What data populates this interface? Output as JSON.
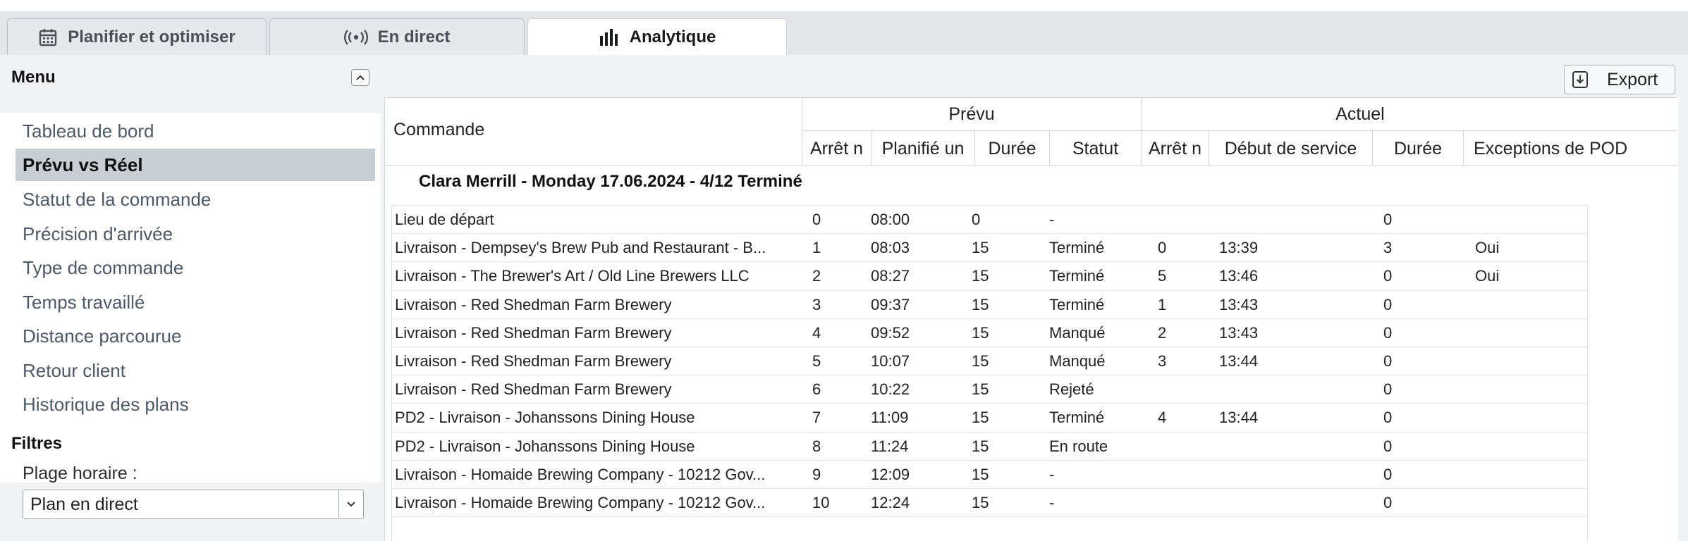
{
  "tabs": [
    {
      "label": "Planifier et optimiser",
      "icon": "calendar-icon"
    },
    {
      "label": "En direct",
      "icon": "broadcast-icon"
    },
    {
      "label": "Analytique",
      "icon": "bar-chart-icon"
    }
  ],
  "sidebar": {
    "menu_title": "Menu",
    "items": [
      {
        "label": "Tableau de bord"
      },
      {
        "label": "Prévu vs Réel"
      },
      {
        "label": "Statut de la commande"
      },
      {
        "label": "Précision d'arrivée"
      },
      {
        "label": "Type de commande"
      },
      {
        "label": "Temps travaillé"
      },
      {
        "label": "Distance parcourue"
      },
      {
        "label": "Retour client"
      },
      {
        "label": "Historique des plans"
      }
    ],
    "active_item": "Prévu vs Réel",
    "filters_title": "Filtres",
    "plage_label": "Plage horaire :",
    "plage_value": "Plan en direct"
  },
  "toolbar": {
    "export_label": "Export"
  },
  "table": {
    "commande_header": "Commande",
    "prevu_header": "Prévu",
    "actuel_header": "Actuel",
    "columns": {
      "arret_prevu": "Arrêt n",
      "planifie": "Planifié un",
      "duree_prevu": "Durée",
      "statut": "Statut",
      "arret_actuel": "Arrêt n",
      "debut_service": "Début de service",
      "duree_actuel": "Durée",
      "exceptions": "Exceptions de POD"
    },
    "group_title": "Clara Merrill - Monday 17.06.2024 - 4/12 Terminé",
    "rows": [
      {
        "commande": "Lieu de départ",
        "arret": "0",
        "planifie": "08:00",
        "duree": "0",
        "statut": "-",
        "arret_actuel": "",
        "debut": "",
        "duree_actuel": "0",
        "pod": ""
      },
      {
        "commande": "Livraison - Dempsey's Brew Pub and Restaurant - B...",
        "arret": "1",
        "planifie": "08:03",
        "duree": "15",
        "statut": "Terminé",
        "arret_actuel": "0",
        "debut": "13:39",
        "duree_actuel": "3",
        "pod": "Oui"
      },
      {
        "commande": "Livraison - The Brewer's Art / Old Line Brewers LLC",
        "arret": "2",
        "planifie": "08:27",
        "duree": "15",
        "statut": "Terminé",
        "arret_actuel": "5",
        "debut": "13:46",
        "duree_actuel": "0",
        "pod": "Oui"
      },
      {
        "commande": "Livraison - Red Shedman Farm Brewery",
        "arret": "3",
        "planifie": "09:37",
        "duree": "15",
        "statut": "Terminé",
        "arret_actuel": "1",
        "debut": "13:43",
        "duree_actuel": "0",
        "pod": ""
      },
      {
        "commande": "Livraison - Red Shedman Farm Brewery",
        "arret": "4",
        "planifie": "09:52",
        "duree": "15",
        "statut": "Manqué",
        "arret_actuel": "2",
        "debut": "13:43",
        "duree_actuel": "0",
        "pod": ""
      },
      {
        "commande": "Livraison - Red Shedman Farm Brewery",
        "arret": "5",
        "planifie": "10:07",
        "duree": "15",
        "statut": "Manqué",
        "arret_actuel": "3",
        "debut": "13:44",
        "duree_actuel": "0",
        "pod": ""
      },
      {
        "commande": "Livraison - Red Shedman Farm Brewery",
        "arret": "6",
        "planifie": "10:22",
        "duree": "15",
        "statut": "Rejeté",
        "arret_actuel": "",
        "debut": "",
        "duree_actuel": "0",
        "pod": ""
      },
      {
        "commande": "PD2 - Livraison - Johanssons Dining House",
        "arret": "7",
        "planifie": "11:09",
        "duree": "15",
        "statut": "Terminé",
        "arret_actuel": "4",
        "debut": "13:44",
        "duree_actuel": "0",
        "pod": ""
      },
      {
        "commande": "PD2 - Livraison - Johanssons Dining House",
        "arret": "8",
        "planifie": "11:24",
        "duree": "15",
        "statut": "En route",
        "arret_actuel": "",
        "debut": "",
        "duree_actuel": "0",
        "pod": ""
      },
      {
        "commande": "Livraison - Homaide Brewing Company - 10212 Gov...",
        "arret": "9",
        "planifie": "12:09",
        "duree": "15",
        "statut": "-",
        "arret_actuel": "",
        "debut": "",
        "duree_actuel": "0",
        "pod": ""
      },
      {
        "commande": "Livraison - Homaide Brewing Company - 10212 Gov...",
        "arret": "10",
        "planifie": "12:24",
        "duree": "15",
        "statut": "-",
        "arret_actuel": "",
        "debut": "",
        "duree_actuel": "0",
        "pod": ""
      }
    ]
  }
}
